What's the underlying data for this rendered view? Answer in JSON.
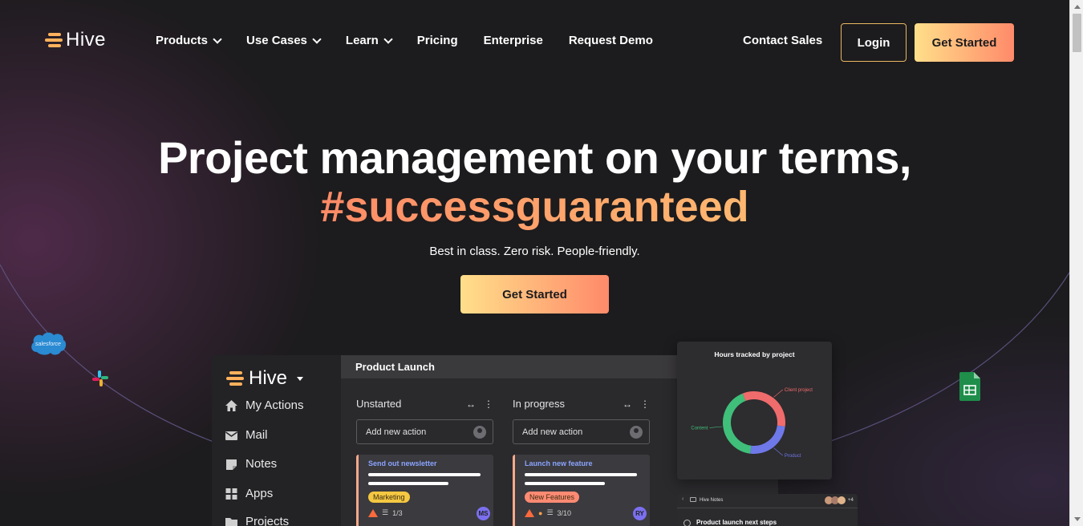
{
  "brand": {
    "name": "Hive",
    "accent": "#ffb15c"
  },
  "nav": {
    "items": [
      {
        "label": "Products",
        "dropdown": true
      },
      {
        "label": "Use Cases",
        "dropdown": true
      },
      {
        "label": "Learn",
        "dropdown": true
      },
      {
        "label": "Pricing",
        "dropdown": false
      },
      {
        "label": "Enterprise",
        "dropdown": false
      },
      {
        "label": "Request Demo",
        "dropdown": false
      }
    ],
    "contact": "Contact Sales",
    "login": "Login",
    "cta": "Get Started"
  },
  "hero": {
    "title": "Project management on your terms,",
    "tagline": "#successguaranteed",
    "subtitle": "Best in class. Zero risk. People-friendly.",
    "cta": "Get Started"
  },
  "integrations": {
    "salesforce": "salesforce"
  },
  "app": {
    "workspace": "Hive",
    "sidebar": [
      {
        "label": "My Actions",
        "icon": "home-icon"
      },
      {
        "label": "Mail",
        "icon": "mail-icon"
      },
      {
        "label": "Notes",
        "icon": "notes-icon"
      },
      {
        "label": "Apps",
        "icon": "apps-icon"
      },
      {
        "label": "Projects",
        "icon": "folder-icon"
      }
    ],
    "project": "Product Launch",
    "columns": [
      {
        "name": "Unstarted",
        "add_placeholder": "Add new action",
        "card": {
          "title": "Send out newsletter",
          "tag": "Marketing",
          "tag_color": "#f5c842",
          "subtasks": "1/3",
          "assignee": "MS"
        }
      },
      {
        "name": "In progress",
        "add_placeholder": "Add new action",
        "card": {
          "title": "Launch new feature",
          "tag": "New Features",
          "tag_color": "#ff8a73",
          "subtasks": "3/10",
          "assignee": "RY"
        }
      }
    ],
    "hours_chart": {
      "title": "Hours tracked by project",
      "chart_data": {
        "type": "pie",
        "title": "Hours tracked by project",
        "categories": [
          "Client project",
          "Product",
          "Content"
        ],
        "values": [
          33,
          25,
          42
        ],
        "colors": [
          "#f06b6b",
          "#6f78e8",
          "#3fbf7a"
        ]
      }
    },
    "notes": {
      "label": "Hive Notes",
      "heading": "Product launch next steps",
      "count": "+4"
    }
  }
}
